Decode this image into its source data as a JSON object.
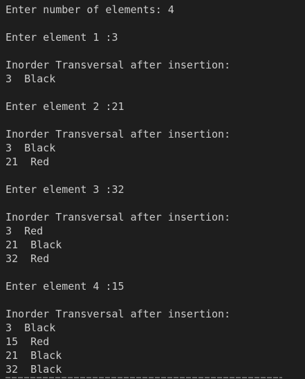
{
  "terminal": {
    "output": "Enter number of elements: 4\n\nEnter element 1 :3\n\nInorder Transversal after insertion:\n3  Black\n\nEnter element 2 :21\n\nInorder Transversal after insertion:\n3  Black\n21  Red\n\nEnter element 3 :32\n\nInorder Transversal after insertion:\n3  Red\n21  Black\n32  Red\n\nEnter element 4 :15\n\nInorder Transversal after insertion:\n3  Black\n15  Red\n21  Black\n32  Black"
  }
}
